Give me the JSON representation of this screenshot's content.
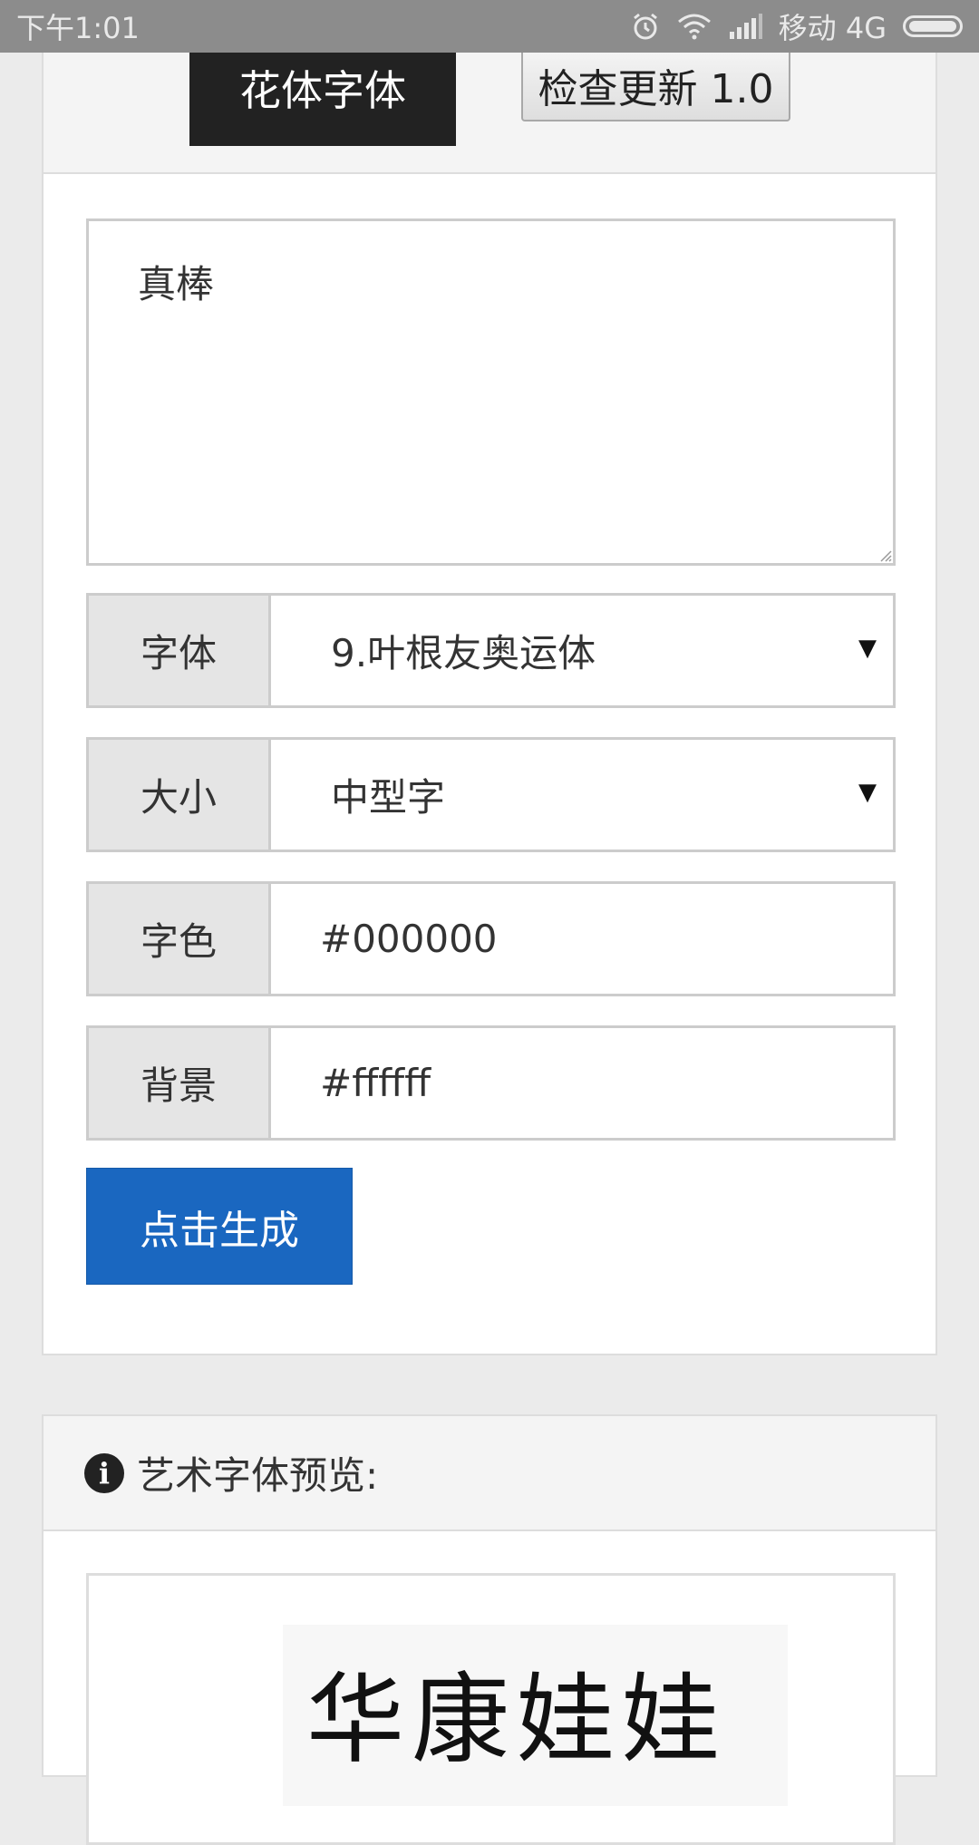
{
  "status_bar": {
    "time": "下午1:01",
    "carrier": "移动 4G",
    "icons": [
      "alarm-icon",
      "wifi-icon",
      "signal-icon",
      "battery-icon"
    ]
  },
  "header": {
    "brand": "花体字体",
    "update_button": "检查更新 1.0"
  },
  "form": {
    "text_value": "真棒",
    "font": {
      "label": "字体",
      "value": "9.叶根友奥运体"
    },
    "size": {
      "label": "大小",
      "value": "中型字"
    },
    "color": {
      "label": "字色",
      "value": "#000000"
    },
    "background": {
      "label": "背景",
      "value": "#ffffff"
    },
    "generate_button": "点击生成"
  },
  "preview": {
    "title": "艺术字体预览:",
    "image_text": "华康娃娃"
  },
  "colors": {
    "brand_bg": "#222222",
    "primary": "#1a67c0",
    "status_bar": "#8c8c8c"
  }
}
